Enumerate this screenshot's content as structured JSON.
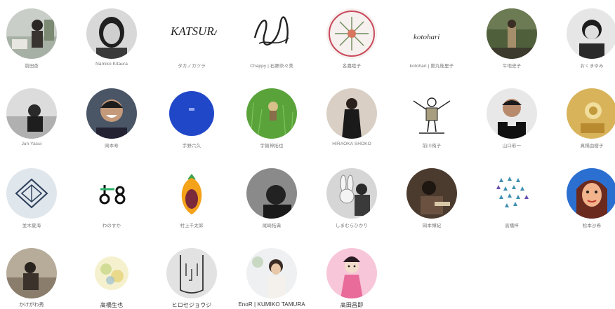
{
  "artists": [
    {
      "name": "前田杏"
    },
    {
      "name": "Namiko Kitaura"
    },
    {
      "name": "タカノカツラ"
    },
    {
      "name": "Chappy | 石郷奈々美"
    },
    {
      "name": "名嘉睦子"
    },
    {
      "name": "kotohari | 曽丸桂里子"
    },
    {
      "name": "牛地史子"
    },
    {
      "name": "おくまゆみ"
    },
    {
      "name": "Jun Yasui"
    },
    {
      "name": "岡本寿"
    },
    {
      "name": "手野六久"
    },
    {
      "name": "宇賀神拓也"
    },
    {
      "name": "HIRAOKA SHOKO"
    },
    {
      "name": "前川侑子"
    },
    {
      "name": "山口彩一"
    },
    {
      "name": "真鍋由樹子"
    },
    {
      "name": "並木夏海"
    },
    {
      "name": "わのすか"
    },
    {
      "name": "村上千太郎"
    },
    {
      "name": "尾崎拓典"
    },
    {
      "name": "しまむらひかり"
    },
    {
      "name": "岡本博紀"
    },
    {
      "name": "高橋梓"
    },
    {
      "name": "松本沙希"
    },
    {
      "name": "かけがわ秀"
    },
    {
      "name": "高橋生也"
    },
    {
      "name": "ヒロセジョウジ"
    },
    {
      "name": "EnoR | KUMIKO TAMURA"
    },
    {
      "name": "高田昌即"
    }
  ],
  "logo_texts": {
    "katsura": "KATSURA",
    "kotohari": "kotohari"
  }
}
